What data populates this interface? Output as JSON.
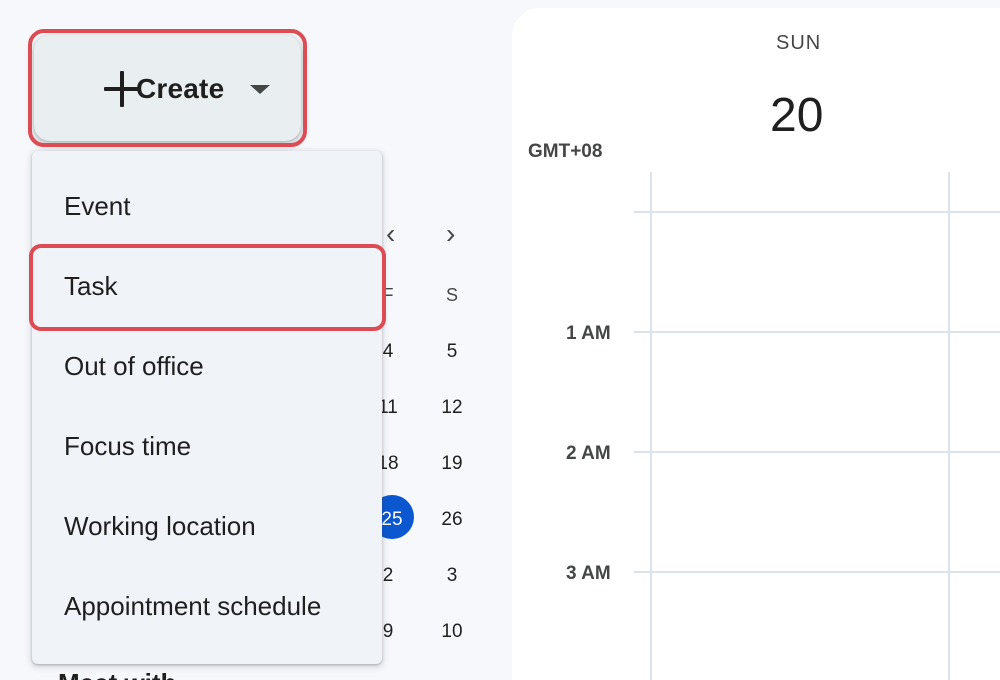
{
  "create_button": {
    "label": "Create"
  },
  "menu": {
    "items": [
      {
        "label": "Event"
      },
      {
        "label": "Task"
      },
      {
        "label": "Out of office"
      },
      {
        "label": "Focus time"
      },
      {
        "label": "Working location"
      },
      {
        "label": "Appointment schedule"
      }
    ]
  },
  "mini_calendar": {
    "prev": "‹",
    "next": "›",
    "headers": [
      "F",
      "S"
    ],
    "rows": [
      [
        "4",
        "5"
      ],
      [
        "11",
        "12"
      ],
      [
        "18",
        "19"
      ],
      [
        "25",
        "26"
      ],
      [
        "2",
        "3"
      ],
      [
        "9",
        "10"
      ]
    ],
    "today": "25"
  },
  "meet_section_peek": "Meet with",
  "day_view": {
    "day_name": "SUN",
    "day_number": "20",
    "timezone": "GMT+08",
    "hours": [
      "1 AM",
      "2 AM",
      "3 AM"
    ]
  },
  "colors": {
    "highlight": "#dc4c55",
    "accent": "#0b57d0",
    "menu_bg": "#f0f4f9"
  }
}
